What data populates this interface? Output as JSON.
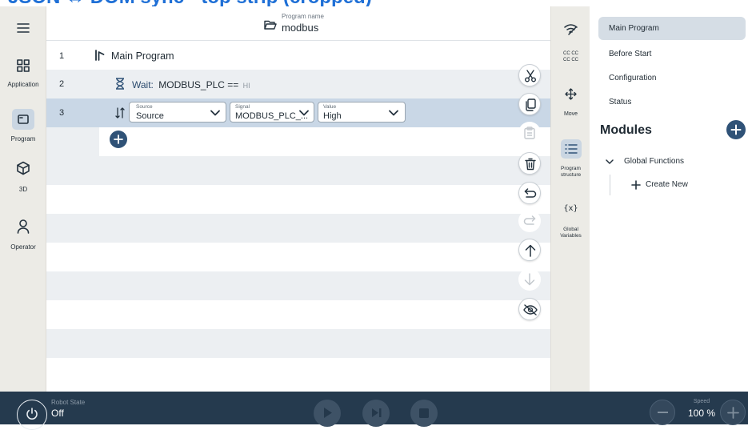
{
  "banner": {
    "text": "JSON ↔ DOM sync · top strip (cropped)"
  },
  "left_nav": {
    "items": [
      {
        "label": "Application",
        "icon": "grid-icon"
      },
      {
        "label": "Program",
        "icon": "program-icon"
      },
      {
        "label": "3D",
        "icon": "cube-icon"
      },
      {
        "label": "Operator",
        "icon": "person-icon"
      }
    ]
  },
  "header": {
    "caption": "Program name",
    "name": "modbus"
  },
  "program": {
    "rows": [
      {
        "num": "1",
        "text": "Main Program"
      },
      {
        "num": "2",
        "wait_label": "Wait:",
        "wait_expr": "MODBUS_PLC ==",
        "wait_value": "HI"
      },
      {
        "num": "3"
      }
    ],
    "set_row": {
      "source": {
        "label": "Source",
        "value": "Source"
      },
      "signal": {
        "label": "Signal",
        "value": "MODBUS_PLC_..."
      },
      "value": {
        "label": "Value",
        "value": "High"
      }
    }
  },
  "toolbar": {
    "cut": "scissors-icon",
    "copy": "copy-icon",
    "paste": "clipboard-icon",
    "delete": "trash-icon",
    "undo": "undo-icon",
    "redo": "redo-icon",
    "up": "arrow-up-icon",
    "down": "arrow-down-icon",
    "hide": "eye-off-icon"
  },
  "side_panel": {
    "cc_label": "CC CC\nCC CC",
    "move_label": "Move",
    "structure_label": "Program\nstructure",
    "vars_label": "Global\nVariables",
    "vars_glyph": "{x}"
  },
  "right_panel": {
    "items": [
      "Main Program",
      "Before Start",
      "Configuration",
      "Status"
    ],
    "modules_title": "Modules",
    "global_functions": "Global Functions",
    "create_new": "Create New"
  },
  "footer": {
    "robot_state_label": "Robot State",
    "robot_state_value": "Off",
    "speed_label": "Speed",
    "speed_value": "100 %"
  },
  "colors": {
    "nav_bg": "#ecebe6",
    "selected": "#c9d7e6",
    "alt_row": "#eceff2",
    "accent": "#2f5277",
    "footer": "#253a4e",
    "rightsel": "#d5dde5"
  }
}
